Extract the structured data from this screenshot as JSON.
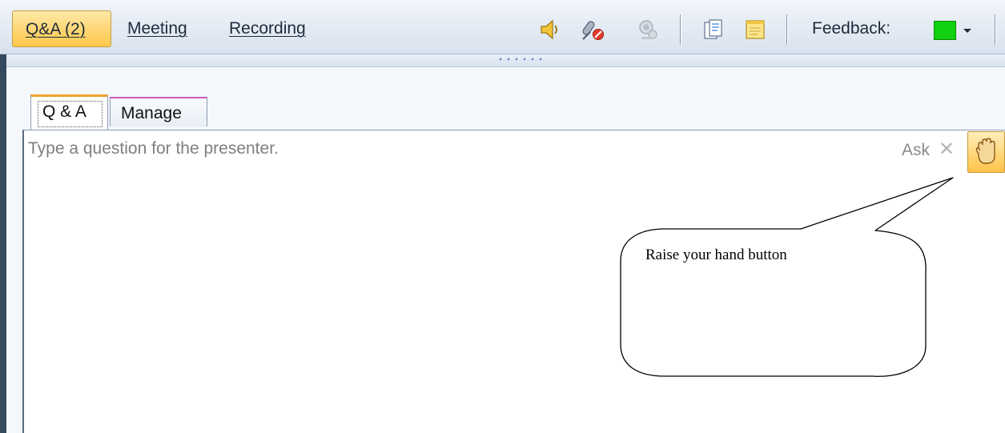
{
  "toolbar": {
    "tabs": [
      {
        "label": "Q&A (2)"
      },
      {
        "label": "Meeting"
      },
      {
        "label": "Recording"
      }
    ],
    "icons": [
      "speaker-icon",
      "mic-muted-icon",
      "webcam-icon",
      "handout-icon",
      "notes-icon"
    ],
    "feedback_label": "Feedback:",
    "feedback_color": "#10d010"
  },
  "panel": {
    "tabs": [
      {
        "label": "Q & A",
        "active": true
      },
      {
        "label": "Manage",
        "active": false
      }
    ]
  },
  "question": {
    "placeholder": "Type a question for the presenter.",
    "value": ""
  },
  "actions": {
    "ask_label": "Ask",
    "clear_glyph": "✕",
    "raise_hand_icon": "raise-hand-icon"
  },
  "annotation": {
    "text": "Raise your hand button"
  },
  "colors": {
    "accent_orange": "#ffc94a",
    "tab_active_top": "#f0a030",
    "tab_manage_top": "#c55cc5",
    "rail": "#35495f"
  }
}
